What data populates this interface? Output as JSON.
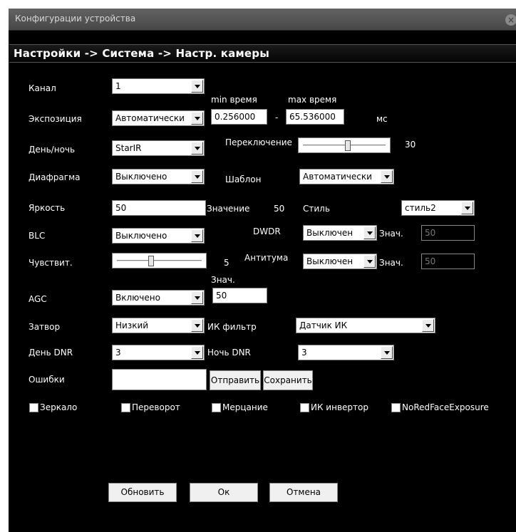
{
  "window": {
    "title": "Конфигурации устройства",
    "close": "×"
  },
  "header": {
    "text": "Настройки -> Система -> Настр. камеры"
  },
  "labels": {
    "channel": "Канал",
    "exposure": "Экспозиция",
    "min_time": "min время",
    "max_time": "max время",
    "ms": "мс",
    "day_night": "День/ночь",
    "switch": "Переключение",
    "iris": "Диафрагма",
    "template": "Шаблон",
    "brightness": "Яркость",
    "value": "Значение",
    "style": "Стиль",
    "blc": "BLC",
    "dwdr": "DWDR",
    "znach1": "Знач.",
    "sensitivity": "Чувствит.",
    "antitum": "Антитума",
    "znach2": "Знач.",
    "znach3": "Знач.",
    "agc": "AGC",
    "shutter": "Затвор",
    "ir_filter": "ИК фильтр",
    "day_dnr": "День DNR",
    "night_dnr": "Ночь DNR",
    "errors": "Ошибки"
  },
  "values": {
    "channel": "1",
    "exposure": "Автоматически",
    "min_time": "0.256000",
    "dash": "-",
    "max_time": "65.536000",
    "day_night": "StarIR",
    "switch_value": "30",
    "iris": "Выключено",
    "template": "Автоматически",
    "brightness": "50",
    "value_num": "50",
    "style": "стиль2",
    "blc": "Выключено",
    "dwdr": "Выключен",
    "dwdr_val": "50",
    "sensitivity_value": "5",
    "antitum": "Выключен",
    "antitum_val": "50",
    "agc": "Включено",
    "agc_val": "50",
    "shutter": "Низкий",
    "ir_filter": "Датчик ИК",
    "day_dnr": "3",
    "night_dnr": "3",
    "errors": ""
  },
  "sliders": {
    "switch_level": 0.55,
    "sensitivity_level": 0.4
  },
  "buttons": {
    "send": "Отправить",
    "save": "Сохранить",
    "refresh": "Обновить",
    "ok": "Ок",
    "cancel": "Отмена"
  },
  "checkboxes": {
    "mirror": "Зеркало",
    "flip": "Переворот",
    "flicker": "Мерцание",
    "ir_invert": "ИК инвертор",
    "noredface": "NoRedFaceExposure"
  }
}
